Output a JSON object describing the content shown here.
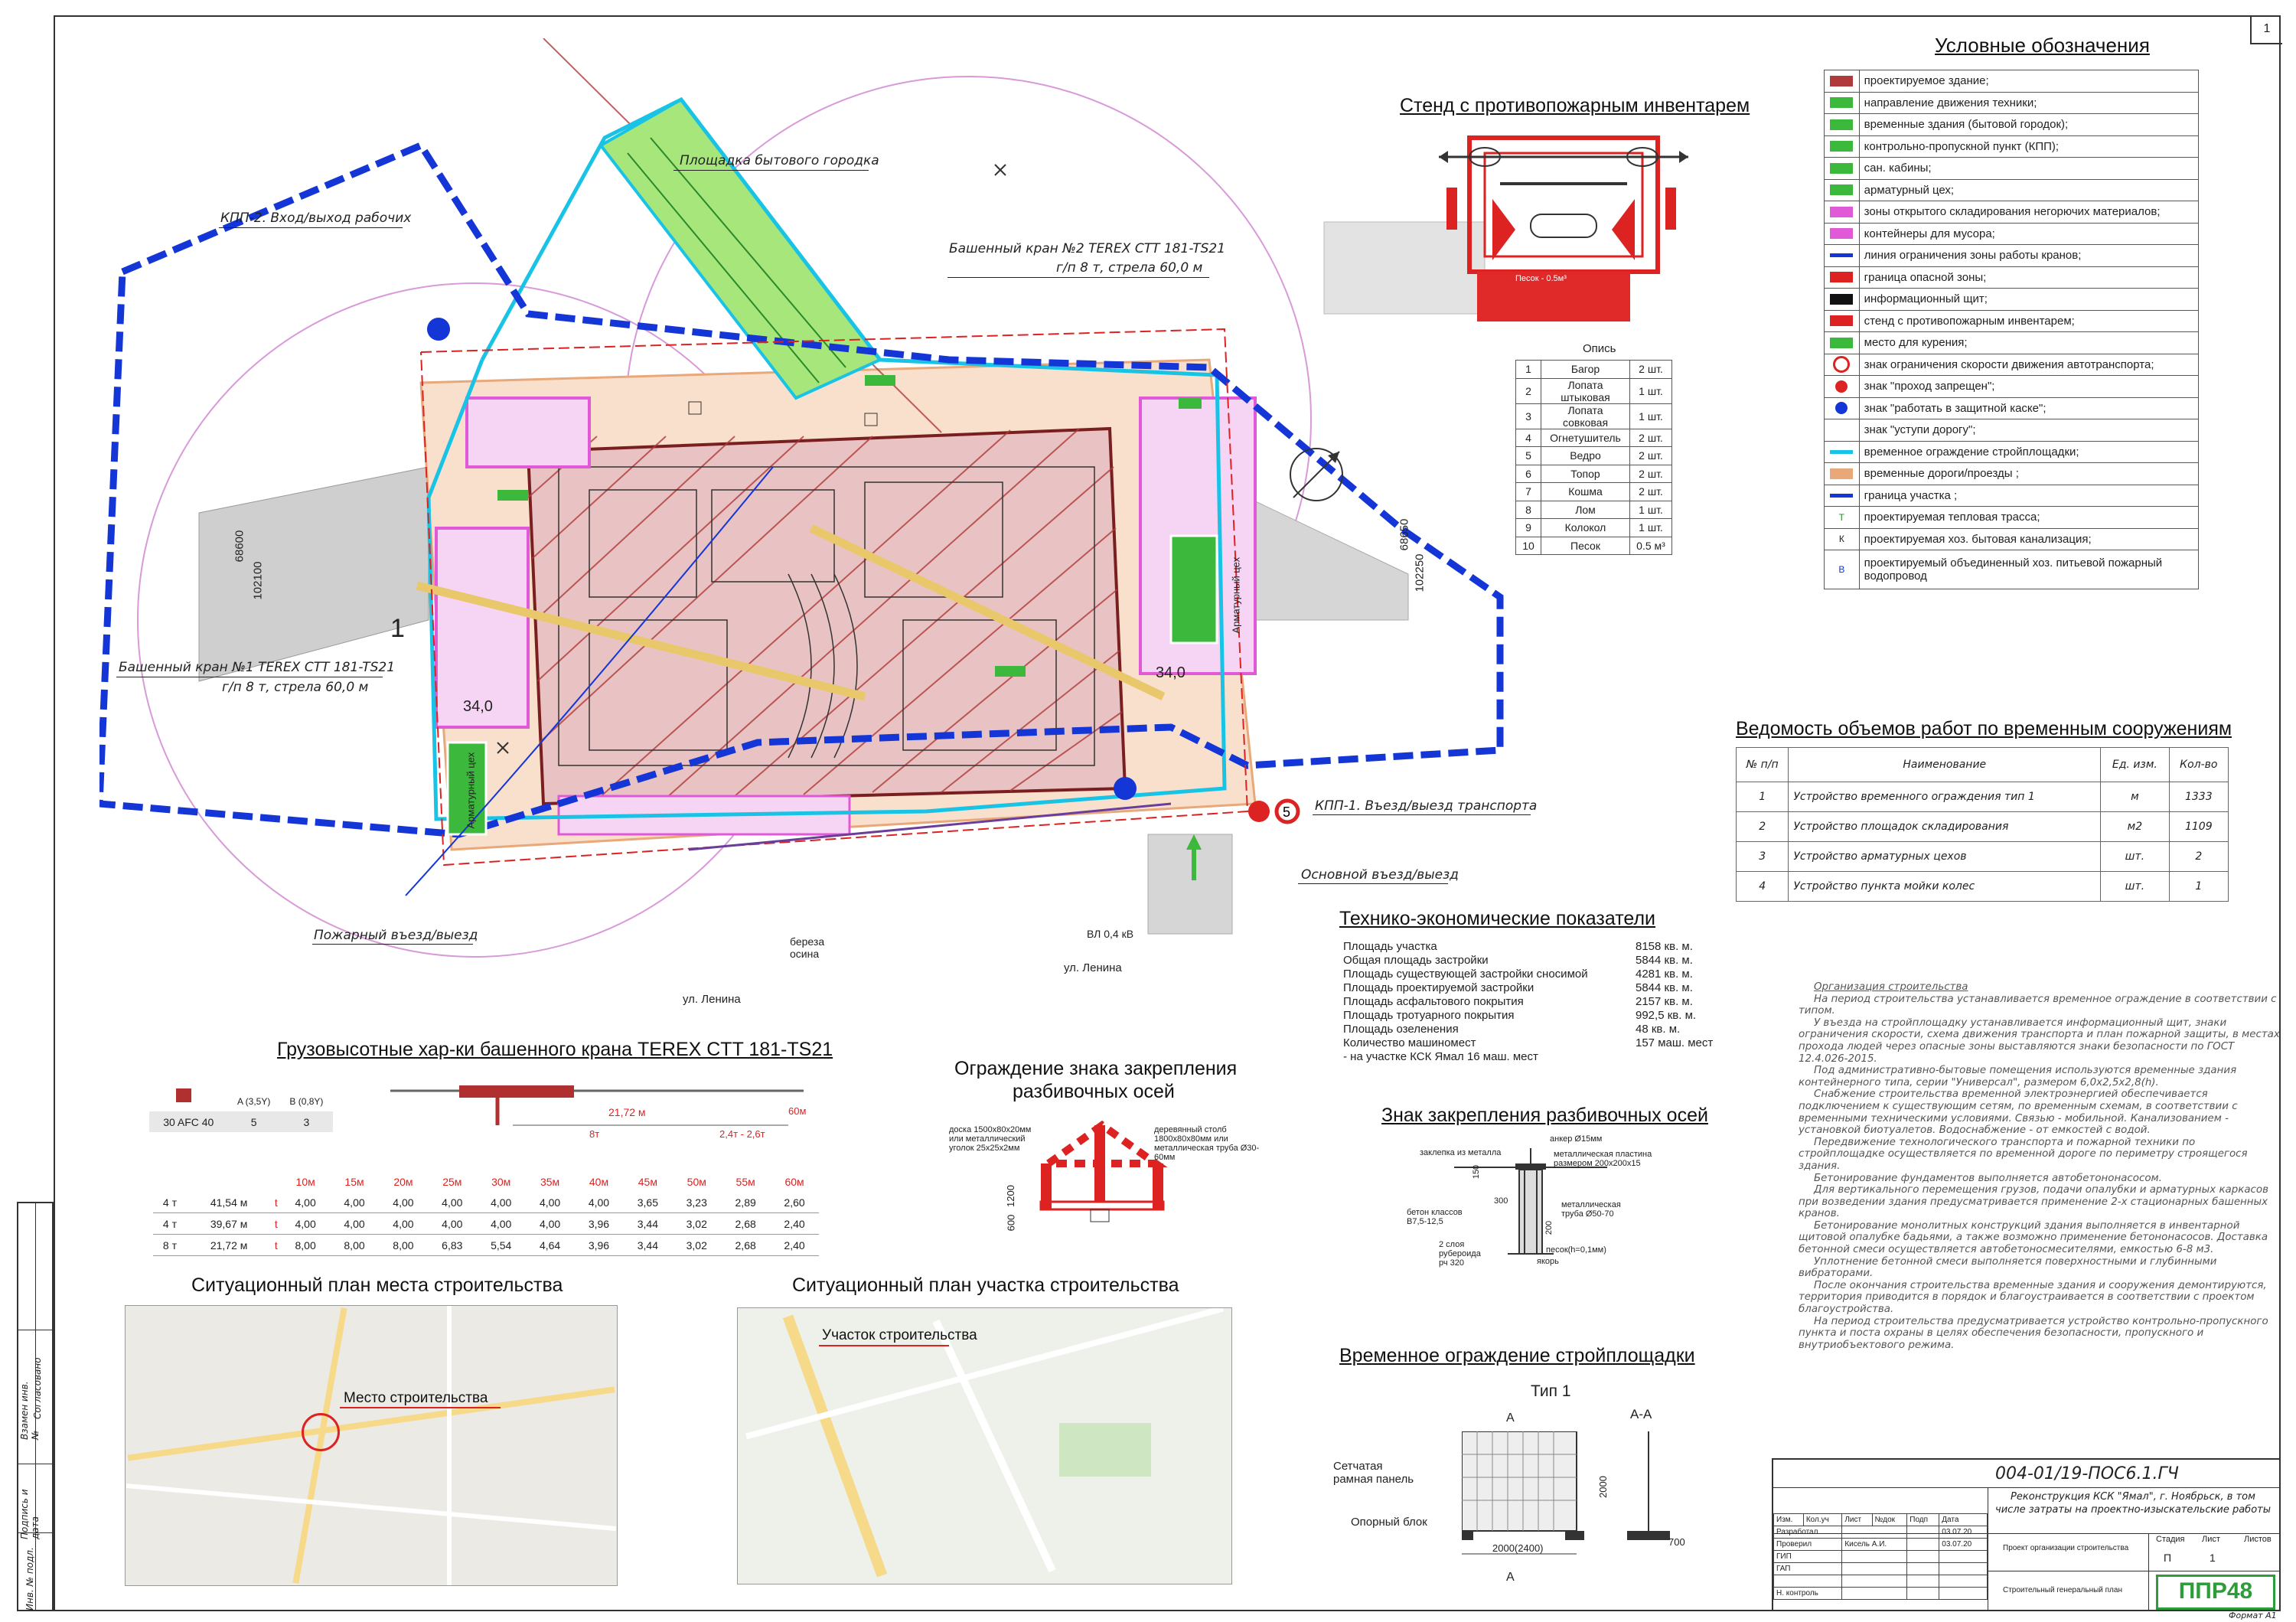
{
  "sheet_number": "1",
  "legend": {
    "title": "Условные обозначения",
    "items": [
      {
        "icon": "hatched-building-icon",
        "label": "проектируемое здание;"
      },
      {
        "icon": "green-double-arrow-icon",
        "label": "направление движения техники;"
      },
      {
        "icon": "temporary-building-icon",
        "label": "временные здания (бытовой городок);"
      },
      {
        "icon": "checkpoint-icon",
        "label": "контрольно-пропускной пункт (КПП);"
      },
      {
        "icon": "toilet-cabin-icon",
        "label": "сан. кабины;"
      },
      {
        "icon": "rebar-shop-icon",
        "label": "арматурный цех;"
      },
      {
        "icon": "storage-zone-icon",
        "label": "зоны открытого складирования негорючих материалов;"
      },
      {
        "icon": "waste-container-icon",
        "label": "контейнеры для мусора;"
      },
      {
        "icon": "crane-zone-line-icon",
        "label": "линия ограничения зоны работы кранов;"
      },
      {
        "icon": "danger-zone-icon",
        "label": "граница опасной зоны;"
      },
      {
        "icon": "info-board-icon",
        "label": "информационный щит;"
      },
      {
        "icon": "fire-stand-icon",
        "label": "стенд с противопожарным инвентарем;"
      },
      {
        "icon": "smoking-place-icon",
        "label": "место для курения;"
      },
      {
        "icon": "speed-limit-icon",
        "label": "знак ограничения скорости движения автотранспорта;"
      },
      {
        "icon": "no-entry-icon",
        "label": "знак \"проход запрещен\";"
      },
      {
        "icon": "helmet-sign-icon",
        "label": "знак \"работать в защитной каске\";"
      },
      {
        "icon": "yield-sign-icon",
        "label": "знак \"уступи дорогу\";"
      },
      {
        "icon": "temp-fence-icon",
        "label": "временное ограждение стройплощадки;"
      },
      {
        "icon": "temp-road-icon",
        "label": "временные дороги/проезды ;"
      },
      {
        "icon": "site-boundary-icon",
        "label": "граница участка ;"
      },
      {
        "icon": "heat-line-icon",
        "label": "проектируемая тепловая трасса;"
      },
      {
        "icon": "sewer-line-icon",
        "label": "проектируемая хоз. бытовая канализация;"
      },
      {
        "icon": "water-line-icon",
        "label": "проектируемый объединенный хоз. питьевой пожарный водопровод"
      }
    ],
    "line_codes": {
      "heat": "Т",
      "sewer": "К",
      "water": "В"
    }
  },
  "fire_stand": {
    "title": "Стенд с противопожарным инвентарем",
    "box_label": "Песок - 0.5м³",
    "opis_title": "Опись",
    "rows": [
      [
        "1",
        "Багор",
        "2 шт."
      ],
      [
        "2",
        "Лопата штыковая",
        "1 шт."
      ],
      [
        "3",
        "Лопата совковая",
        "1 шт."
      ],
      [
        "4",
        "Огнетушитель",
        "2 шт."
      ],
      [
        "5",
        "Ведро",
        "2 шт."
      ],
      [
        "6",
        "Топор",
        "2 шт."
      ],
      [
        "7",
        "Кошма",
        "2 шт."
      ],
      [
        "8",
        "Лом",
        "1 шт."
      ],
      [
        "9",
        "Колокол",
        "1 шт."
      ],
      [
        "10",
        "Песок",
        "0.5 м³"
      ]
    ]
  },
  "volumes": {
    "title": "Ведомость объемов работ по  временным сооружениям",
    "headers": [
      "№ п/п",
      "Наименование",
      "Ед. изм.",
      "Кол-во"
    ],
    "rows": [
      [
        "1",
        "Устройство временного ограждения тип 1",
        "м",
        "1333"
      ],
      [
        "2",
        "Устройство площадок складирования",
        "м2",
        "1109"
      ],
      [
        "3",
        "Устройство арматурных цехов",
        "шт.",
        "2"
      ],
      [
        "4",
        "Устройство пункта мойки колес",
        "шт.",
        "1"
      ]
    ]
  },
  "tep": {
    "title": "Технико-экономические показатели",
    "rows": [
      [
        "Площадь участка",
        "8158 кв. м."
      ],
      [
        "Общая площадь застройки",
        "5844 кв. м."
      ],
      [
        "Площадь существующей застройки сносимой",
        "4281 кв. м."
      ],
      [
        "Площадь проектируемой застройки",
        "5844 кв. м."
      ],
      [
        "Площадь асфальтового покрытия",
        "2157 кв. м."
      ],
      [
        "Площадь тротуарного покрытия",
        "992,5 кв. м."
      ],
      [
        "Площадь озеленения",
        "48 кв. м."
      ],
      [
        "Количество машиномест",
        "157 маш. мест"
      ],
      [
        "- на участке КСК Ямал 16 маш. мест",
        ""
      ]
    ]
  },
  "site_plan": {
    "labels": {
      "household_area": "Площадка бытового городка",
      "kpp2": "КПП-2. Вход/выход рабочих",
      "crane2_a": "Башенный кран №2 TEREX CTT 181-TS21",
      "crane2_b": "г/п 8 т, стрела 60,0 м",
      "crane1_a": "Башенный кран №1 TEREX CTT 181-TS21",
      "crane1_b": "г/п 8 т, стрела 60,0 м",
      "kpp1": "КПП-1. Въезд/выезд транспорта",
      "main_entry": "Основной въезд/выезд",
      "fire_entry": "Пожарный въезд/выезд",
      "elev_left": "34,0",
      "elev_right": "34,0",
      "coord_left_a": "68600",
      "coord_left_b": "102100",
      "coord_right_a": "68650",
      "coord_right_b": "102250",
      "street_1": "ул. Ленина",
      "street_2": "ул. Ленина",
      "trees": "береза осина",
      "power": "ВЛ 0,4 кВ",
      "rebar_left": "Арматурный цех",
      "rebar_right": "Арматурный цех",
      "speed": "5",
      "section_mark": "1"
    }
  },
  "crane_chars": {
    "title": "Грузовысотные хар-ки башенного крана TEREX CTT 181-TS21",
    "config": [
      "30 AFC 40",
      "5",
      "3"
    ],
    "config_headers": [
      "A (3,5Y)",
      "B (0,8Y)"
    ],
    "reach_labels": [
      "21,72 м",
      "60м",
      "8т",
      "2,4т - 2,6т"
    ],
    "distances": [
      "10м",
      "15м",
      "20м",
      "25м",
      "30м",
      "35м",
      "40м",
      "45м",
      "50м",
      "55м",
      "60м"
    ],
    "rows": [
      {
        "load": "4 т",
        "boom": "41,54 м",
        "unit": "t",
        "values": [
          "4,00",
          "4,00",
          "4,00",
          "4,00",
          "4,00",
          "4,00",
          "4,00",
          "3,65",
          "3,23",
          "2,89",
          "2,60"
        ]
      },
      {
        "load": "4 т",
        "boom": "39,67 м",
        "unit": "t",
        "values": [
          "4,00",
          "4,00",
          "4,00",
          "4,00",
          "4,00",
          "4,00",
          "3,96",
          "3,44",
          "3,02",
          "2,68",
          "2,40"
        ]
      },
      {
        "load": "8 т",
        "boom": "21,72 м",
        "unit": "t",
        "values": [
          "8,00",
          "8,00",
          "8,00",
          "6,83",
          "5,54",
          "4,64",
          "3,96",
          "3,44",
          "3,02",
          "2,68",
          "2,40"
        ]
      }
    ]
  },
  "sign_fence": {
    "title_a": "Ограждение знака закрепления",
    "title_b": "разбивочных осей",
    "left_note": "доска 1500х80х20мм или металлический уголок 25х25х2мм",
    "right_note": "деревянный столб 1800х80х80мм или металлическая труба Ø30-60мм",
    "dims": [
      "600",
      "1200"
    ]
  },
  "axis_sign": {
    "title": "Знак закрепления разбивочных осей",
    "labels": [
      "заклепка из металла",
      "анкер Ø15мм",
      "металлическая пластина размером 200х200х15",
      "бетон классов В7,5-12,5",
      "металлическая труба Ø50-70",
      "2 слоя рубероида рч 320",
      "песок(h=0,1мм)",
      "якорь"
    ],
    "dims": [
      "150",
      "300",
      "200"
    ]
  },
  "temp_fence": {
    "title": "Временное ограждение стройплощадки",
    "type": "Тип 1",
    "section": "А-А",
    "mark": "А",
    "labels": [
      "Сетчатая рамная панель",
      "Опорный блок"
    ],
    "dims": [
      "2000(2400)",
      "2000",
      "700"
    ]
  },
  "situation_place": {
    "title": "Ситуационный план места строительства",
    "label": "Место строительства"
  },
  "situation_site": {
    "title": "Ситуационный план участка строительства",
    "label": "Участок строительства"
  },
  "notes": {
    "title": "Организация строительства",
    "paragraphs": [
      "На период строительства устанавливается временное ограждение в соответствии с типом.",
      "У въезда на стройплощадку устанавливается информационный щит, знаки ограничения скорости, схема движения транспорта и план пожарной защиты, в местах прохода людей через опасные зоны выставляются знаки безопасности по ГОСТ 12.4.026-2015.",
      "Под административно-бытовые помещения используются временные здания контейнерного типа, серии \"Универсал\", размером 6,0х2,5х2,8(h).",
      "Снабжение строительства временной электроэнергией обеспечивается подключением к существующим сетям, по временным схемам, в соответствии с временными техническими условиями. Связью - мобильной. Канализованием - установкой биотуалетов. Водоснабжение - от емкостей с водой.",
      "Передвижение технологического транспорта и пожарной техники по стройплощадке осуществляется по временной дороге по периметру строящегося здания.",
      "Бетонирование фундаментов выполняется автобетононасосом.",
      "Для вертикального перемещения грузов, подачи опалубки и арматурных каркасов при возведении здания предусматривается применение 2-х стационарных башенных кранов.",
      "Бетонирование монолитных конструкций здания выполняется в инвентарной щитовой опалубке бадьями, а также возможно применение бетононасосов. Доставка бетонной смеси осуществляется автобетоносмесителями, емкостью 6-8 м3.",
      "Уплотнение бетонной смеси выполняется поверхностными и глубинными вибраторами.",
      "После окончания строительства временные здания и сооружения демонтируются, территория приводится в порядок и благоустраивается в соответствии с проектом благоустройства.",
      "На период строительства предусматривается устройство контрольно-пропускного пункта и поста охраны в целях обеспечения безопасности, пропускного и внутриобъектового режима."
    ]
  },
  "stamp": {
    "code": "004-01/19-ПОС6.1.ГЧ",
    "object": "Реконструкция КСК \"Ямал\", г. Ноябрьск, в том числе затраты на проектно-изыскательские работы",
    "section": "Проект организации строительства",
    "sheet_name": "Строительный генеральный план",
    "headers": [
      "Изм.",
      "Кол.уч",
      "Лист",
      "№док",
      "Подп",
      "Дата"
    ],
    "roles": [
      "Разработал",
      "Проверил",
      "ГИП",
      "ГАП",
      "Н. контроль"
    ],
    "checker": "Кисель А.И.",
    "dates": [
      "03.07.20",
      "03.07.20"
    ],
    "stage_headers": [
      "Стадия",
      "Лист",
      "Листов"
    ],
    "stage": "П",
    "sheet": "1",
    "org": "ППР48",
    "format": "Формат А1"
  },
  "side_stamp": [
    "Инв. № подл.",
    "Подпись и дата",
    "Взамен инв. №",
    "Согласовано"
  ],
  "colors": {
    "boundary": "#1436d6",
    "fence": "#19c3e6",
    "building": "#b03a3a",
    "storage": "#e05ad8",
    "green": "#3cb83c",
    "crane": "#e8c86a",
    "danger": "#d22",
    "road": "#e8a87a",
    "stamp_green": "#2e9c3a"
  }
}
